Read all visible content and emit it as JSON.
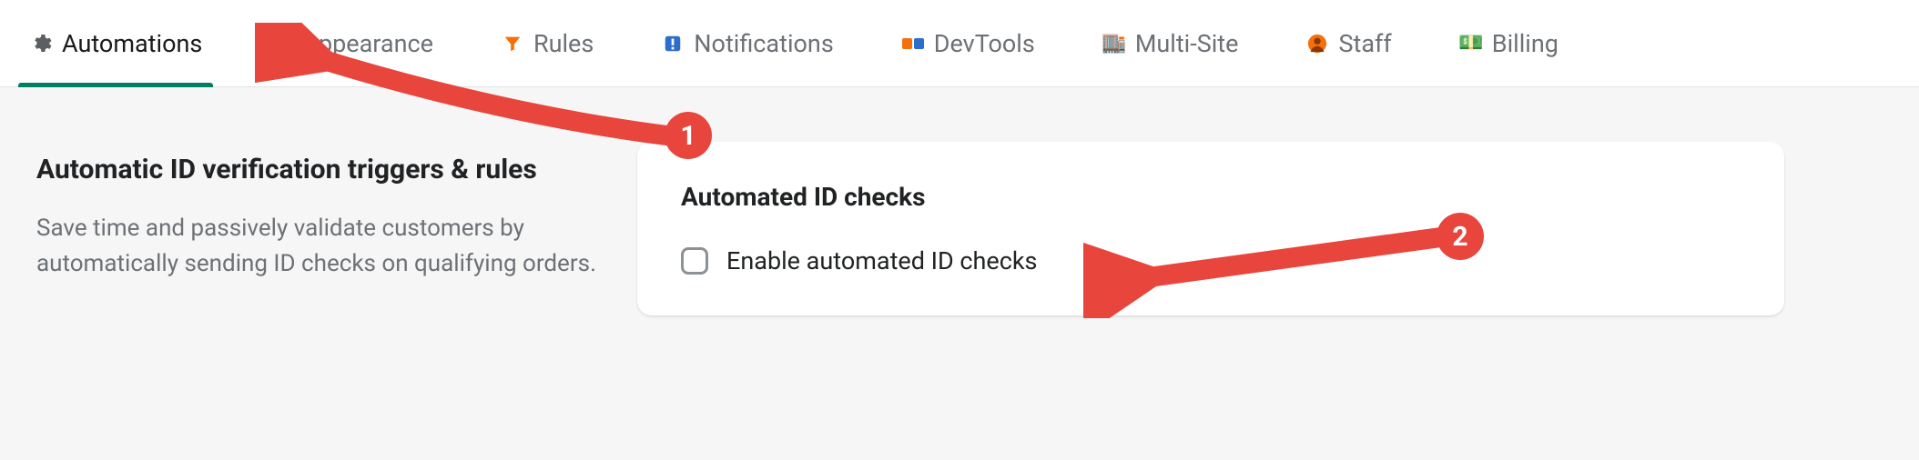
{
  "tabs": {
    "automations": {
      "label": "Automations"
    },
    "appearance": {
      "label": "Appearance"
    },
    "rules": {
      "label": "Rules"
    },
    "notifications": {
      "label": "Notifications"
    },
    "devtools": {
      "label": "DevTools"
    },
    "multisite": {
      "label": "Multi-Site"
    },
    "staff": {
      "label": "Staff"
    },
    "billing": {
      "label": "Billing"
    }
  },
  "section": {
    "title": "Automatic ID verification triggers & rules",
    "desc": "Save time and passively validate customers by automatically sending ID checks on qualifying orders."
  },
  "card": {
    "title": "Automated ID checks",
    "checkbox_label": "Enable automated ID checks"
  },
  "annotations": {
    "num1": "1",
    "num2": "2"
  }
}
